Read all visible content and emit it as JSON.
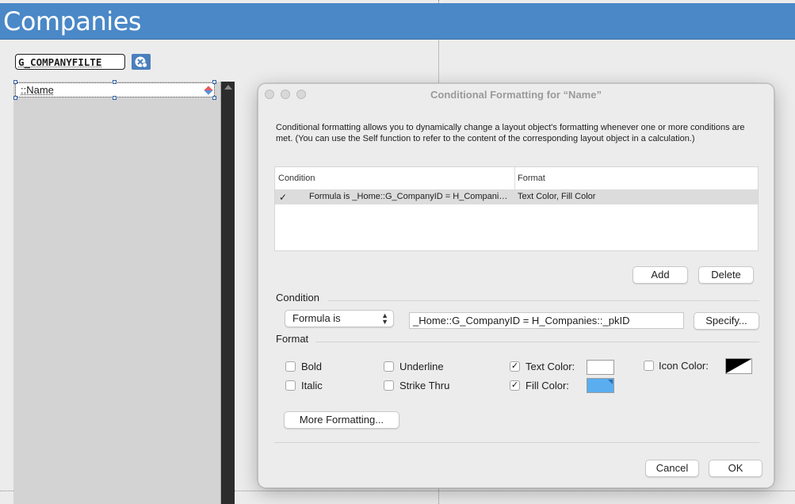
{
  "layout": {
    "header_title": "Companies",
    "filter_field": "G_COMPANYFILTE",
    "name_field": "::Name"
  },
  "dialog": {
    "title": "Conditional Formatting for “Name”",
    "description": "Conditional formatting allows you to dynamically change a layout object's formatting whenever one or more conditions are met.  (You can use the Self function to refer to the content of the corresponding layout object in a calculation.)",
    "table": {
      "headers": {
        "condition": "Condition",
        "format": "Format"
      },
      "rows": [
        {
          "checked": "✓",
          "condition": "Formula is _Home::G_CompanyID = H_Companies::_pkID",
          "format": "Text Color, Fill Color"
        }
      ]
    },
    "buttons": {
      "add": "Add",
      "delete": "Delete",
      "specify": "Specify...",
      "more_formatting": "More Formatting...",
      "cancel": "Cancel",
      "ok": "OK"
    },
    "condition_section": {
      "label": "Condition",
      "type_selected": "Formula is",
      "formula": "_Home::G_CompanyID = H_Companies::_pkID"
    },
    "format_section": {
      "label": "Format",
      "bold": {
        "label": "Bold",
        "checked": ""
      },
      "italic": {
        "label": "Italic",
        "checked": ""
      },
      "underline": {
        "label": "Underline",
        "checked": ""
      },
      "strike_thru": {
        "label": "Strike Thru",
        "checked": ""
      },
      "text_color": {
        "label": "Text Color:",
        "checked": "✓",
        "color": "#ffffff"
      },
      "fill_color": {
        "label": "Fill Color:",
        "checked": "✓",
        "color": "#5aaef0"
      },
      "icon_color": {
        "label": "Icon Color:",
        "checked": ""
      }
    }
  },
  "colors": {
    "header_band": "#4a88c7",
    "fill_swatch": "#5aaef0",
    "text_swatch": "#ffffff"
  }
}
